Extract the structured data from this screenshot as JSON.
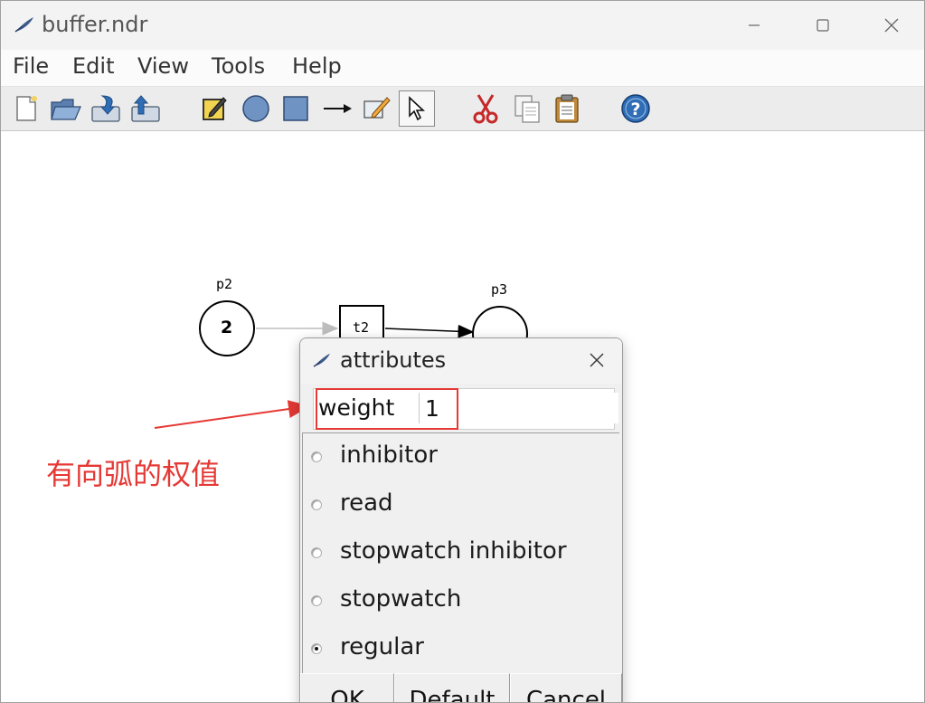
{
  "window": {
    "title": "buffer.ndr"
  },
  "window_controls": {
    "minimize": "minimize-icon",
    "maximize": "maximize-icon",
    "close": "close-icon"
  },
  "menu": {
    "items": [
      "File",
      "Edit",
      "View",
      "Tools",
      "Help"
    ]
  },
  "toolbar": {
    "tools": [
      "new-file-icon",
      "open-folder-icon",
      "import-icon",
      "export-icon",
      "edit-note-icon",
      "place-circle-icon",
      "transition-square-icon",
      "arc-arrow-icon",
      "edit-pen-icon",
      "pointer-icon",
      "cut-scissors-icon",
      "copy-icon",
      "paste-icon",
      "help-icon"
    ],
    "selected": "pointer-icon"
  },
  "net": {
    "places": [
      {
        "label": "p2",
        "tokens": "2"
      },
      {
        "label": "p3",
        "tokens": ""
      }
    ],
    "transitions": [
      {
        "label": "t2"
      }
    ]
  },
  "annotation": {
    "text": "有向弧的权值",
    "color": "#e53935"
  },
  "dialog": {
    "title": "attributes",
    "weight_label": "weight",
    "weight_value": "1",
    "options": [
      {
        "label": "inhibitor",
        "checked": false
      },
      {
        "label": "read",
        "checked": false
      },
      {
        "label": "stopwatch inhibitor",
        "checked": false
      },
      {
        "label": "stopwatch",
        "checked": false
      },
      {
        "label": "regular",
        "checked": true
      }
    ],
    "buttons": {
      "ok": "OK",
      "default": "Default",
      "cancel": "Cancel"
    }
  }
}
